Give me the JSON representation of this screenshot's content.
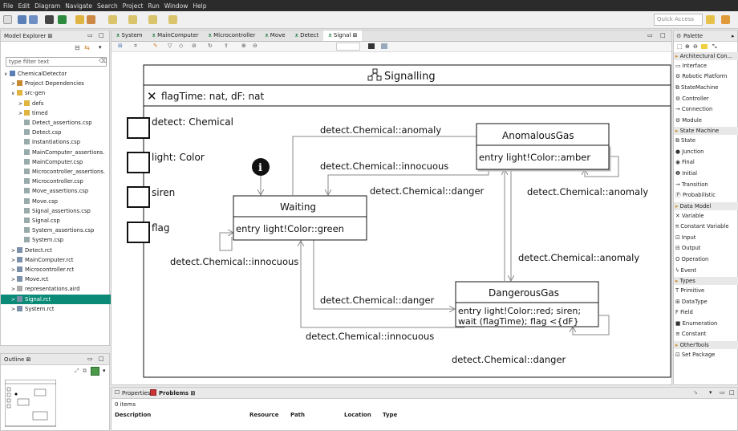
{
  "menu": [
    "File",
    "Edit",
    "Diagram",
    "Navigate",
    "Search",
    "Project",
    "Run",
    "Window",
    "Help"
  ],
  "quick_access": "Quick Access",
  "explorer": {
    "tab": "Model Explorer ⊠",
    "filter_placeholder": "type filter text",
    "items": [
      {
        "label": "ChemicalDetector",
        "indent": 0
      },
      {
        "label": "Project Dependencies",
        "indent": 1
      },
      {
        "label": "src-gen",
        "indent": 1
      },
      {
        "label": "defs",
        "indent": 2
      },
      {
        "label": "timed",
        "indent": 2
      },
      {
        "label": "Detect_assertions.csp",
        "indent": 2
      },
      {
        "label": "Detect.csp",
        "indent": 2
      },
      {
        "label": "Instantiations.csp",
        "indent": 2
      },
      {
        "label": "MainComputer_assertions.",
        "indent": 2
      },
      {
        "label": "MainComputer.csp",
        "indent": 2
      },
      {
        "label": "Microcontroller_assertions.",
        "indent": 2
      },
      {
        "label": "Microcontroller.csp",
        "indent": 2
      },
      {
        "label": "Move_assertions.csp",
        "indent": 2
      },
      {
        "label": "Move.csp",
        "indent": 2
      },
      {
        "label": "Signal_assertions.csp",
        "indent": 2
      },
      {
        "label": "Signal.csp",
        "indent": 2
      },
      {
        "label": "System_assertions.csp",
        "indent": 2
      },
      {
        "label": "System.csp",
        "indent": 2
      },
      {
        "label": "Detect.rct",
        "indent": 1
      },
      {
        "label": "MainComputer.rct",
        "indent": 1
      },
      {
        "label": "Microcontroller.rct",
        "indent": 1
      },
      {
        "label": "Move.rct",
        "indent": 1
      },
      {
        "label": "representations.aird",
        "indent": 1
      },
      {
        "label": "Signal.rct",
        "indent": 1,
        "selected": true
      },
      {
        "label": "System.rct",
        "indent": 1
      }
    ]
  },
  "outline": {
    "tab": "Outline ⊠"
  },
  "editor": {
    "tabs": [
      "System",
      "MainComputer",
      "Microcontroller",
      "Move",
      "Detect",
      "Signal ⊠"
    ]
  },
  "diagram": {
    "title": "Signalling",
    "variables": "flagTime: nat, dF: nat",
    "ports": [
      "detect: Chemical",
      "light: Color",
      "siren",
      "flag"
    ],
    "states": {
      "waiting": {
        "name": "Waiting",
        "action": "entry light!Color::green"
      },
      "anomalous": {
        "name": "AnomalousGas",
        "action": "entry light!Color::amber"
      },
      "dangerous": {
        "name": "DangerousGas",
        "action_line1": "entry light!Color::red; siren;",
        "action_line2": "wait (flagTime); flag <{dF}"
      }
    },
    "transitions": {
      "w_to_a": "detect.Chemical::anomaly",
      "a_to_w": "detect.Chemical::innocuous",
      "a_to_d": "detect.Chemical::danger",
      "a_self": "detect.Chemical::anomaly",
      "w_self": "detect.Chemical::innocuous",
      "d_to_a": "detect.Chemical::anomaly",
      "w_to_d": "detect.Chemical::danger",
      "d_to_w": "detect.Chemical::innocuous",
      "d_self": "detect.Chemical::danger"
    }
  },
  "palette": {
    "title": "Palette",
    "items": [
      {
        "label": "Architectural Con...",
        "head": true
      },
      {
        "label": "Interface"
      },
      {
        "label": "Robotic Platform"
      },
      {
        "label": "StateMachine"
      },
      {
        "label": "Controller"
      },
      {
        "label": "Connection"
      },
      {
        "label": "Module"
      },
      {
        "label": "State Machine",
        "head": true
      },
      {
        "label": "State"
      },
      {
        "label": "Junction"
      },
      {
        "label": "Final"
      },
      {
        "label": "Initial"
      },
      {
        "label": "Transition"
      },
      {
        "label": "Probabilistic"
      },
      {
        "label": "Data Model",
        "head": true
      },
      {
        "label": "Variable"
      },
      {
        "label": "Constant Variable"
      },
      {
        "label": "Input"
      },
      {
        "label": "Output"
      },
      {
        "label": "Operation"
      },
      {
        "label": "Event"
      },
      {
        "label": "Types",
        "head": true
      },
      {
        "label": "Primitive"
      },
      {
        "label": "DataType"
      },
      {
        "label": "Field"
      },
      {
        "label": "Enumeration"
      },
      {
        "label": "Constant"
      },
      {
        "label": "OtherTools",
        "head": true
      },
      {
        "label": "Set Package"
      }
    ]
  },
  "problems": {
    "tab_properties": "Properties",
    "tab_problems": "Problems ⊠",
    "count": "0 items",
    "columns": [
      "Description",
      "Resource",
      "Path",
      "Location",
      "Type"
    ]
  }
}
